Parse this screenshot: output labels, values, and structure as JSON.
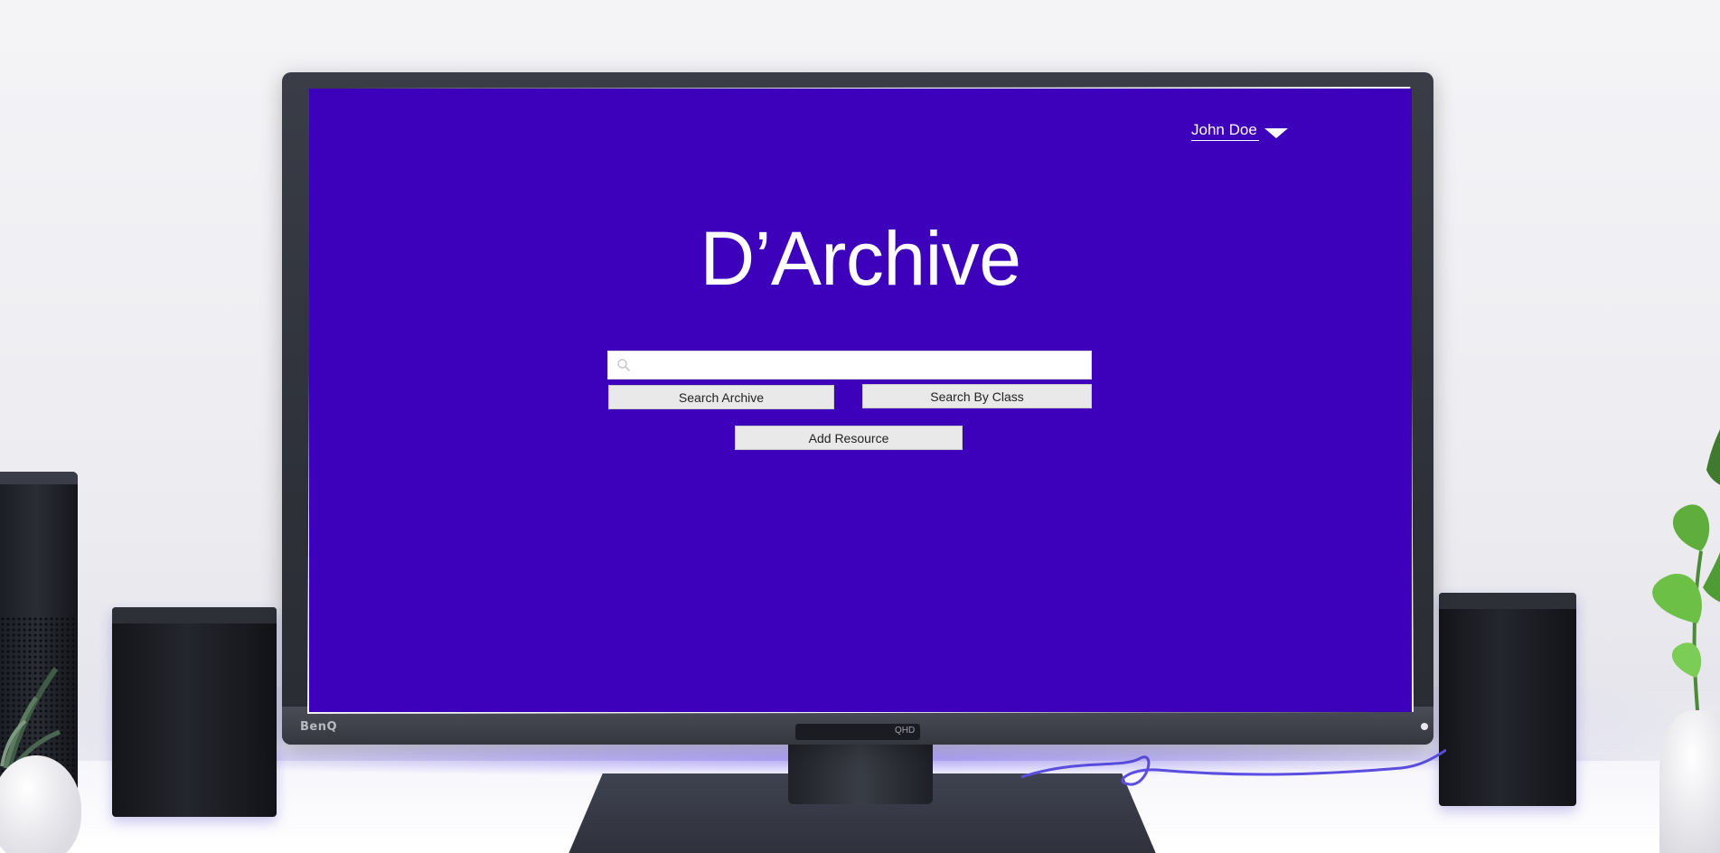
{
  "app": {
    "title": "D’Archive"
  },
  "user_menu": {
    "name": "John Doe",
    "icon": "caret-down-icon"
  },
  "search": {
    "placeholder": "",
    "value": "",
    "icon": "search-icon"
  },
  "buttons": {
    "search_archive": "Search Archive",
    "search_by_class": "Search By Class",
    "add_resource": "Add Resource"
  },
  "monitor": {
    "brand": "BenQ",
    "badge": "QHD"
  },
  "colors": {
    "screen_background": "#3d00bb",
    "title_text": "#ffffff",
    "button_background": "#e9e9e9",
    "button_text": "#222222"
  }
}
